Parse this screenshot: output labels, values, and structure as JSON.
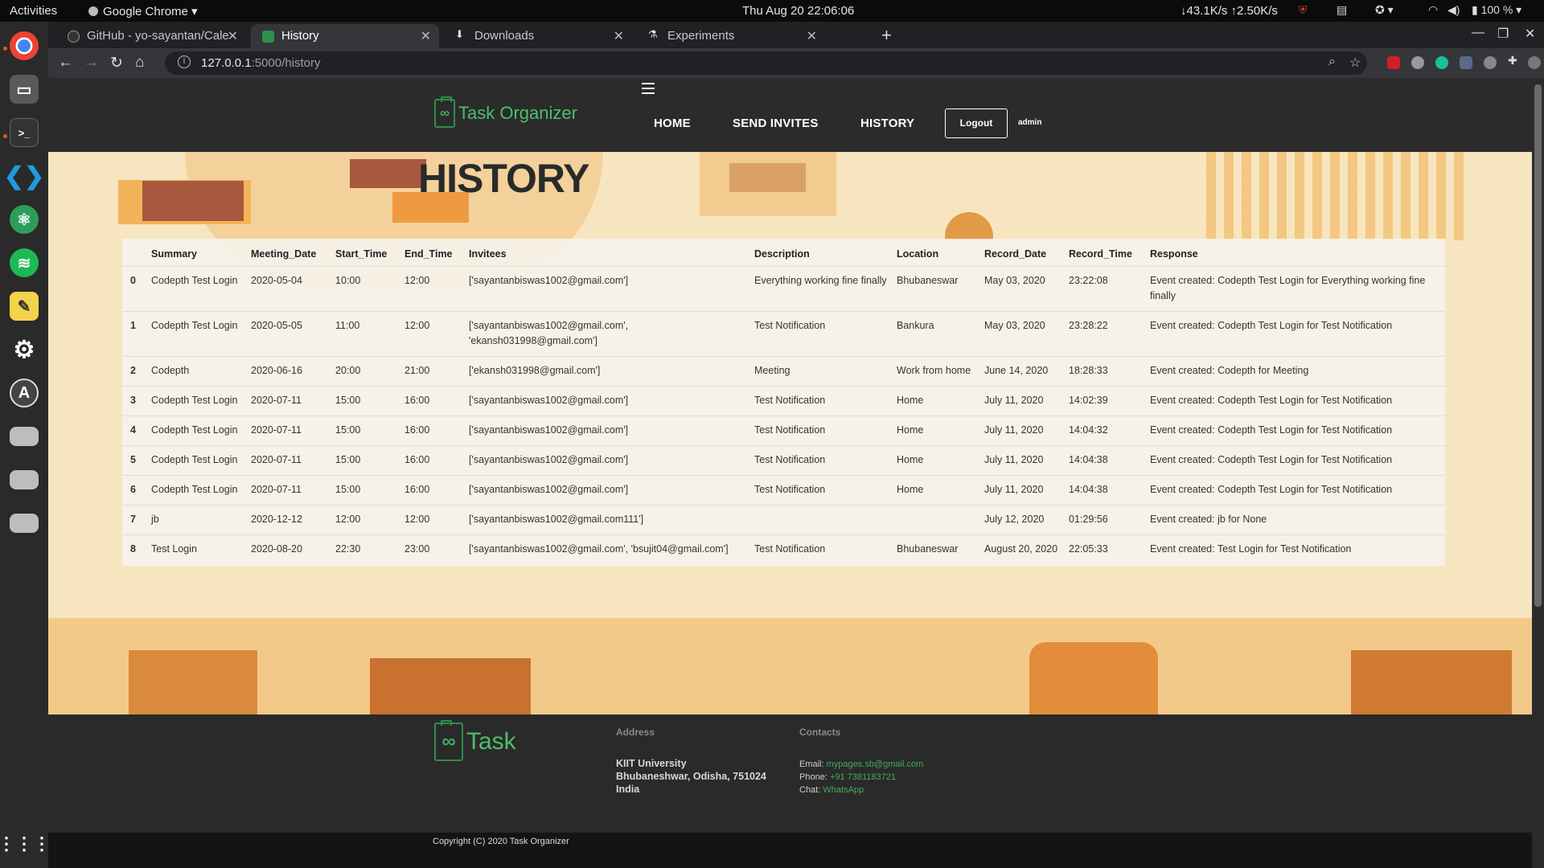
{
  "os": {
    "activities": "Activities",
    "app_name": "Google Chrome",
    "clock": "Thu Aug 20  22:06:06",
    "netspeed": "↓43.1K/s ↑2.50K/s",
    "battery": "100 %"
  },
  "browser": {
    "tabs": [
      {
        "title": "GitHub - yo-sayantan/Cale",
        "active": false
      },
      {
        "title": "History",
        "active": true
      },
      {
        "title": "Downloads",
        "active": false
      },
      {
        "title": "Experiments",
        "active": false
      }
    ],
    "url_host": "127.0.0.1",
    "url_path": ":5000/history"
  },
  "site": {
    "brand": "Task Organizer",
    "nav": {
      "home": "HOME",
      "send_invites": "SEND INVITES",
      "history": "HISTORY",
      "logout": "Logout",
      "user": "admin"
    },
    "title": "HISTORY",
    "table": {
      "headers": [
        "",
        "Summary",
        "Meeting_Date",
        "Start_Time",
        "End_Time",
        "Invitees",
        "Description",
        "Location",
        "Record_Date",
        "Record_Time",
        "Response"
      ],
      "rows": [
        [
          "0",
          "Codepth Test Login",
          "2020-05-04",
          "10:00",
          "12:00",
          "['sayantanbiswas1002@gmail.com']",
          "Everything working fine finally",
          "Bhubaneswar",
          "May 03, 2020",
          "23:22:08",
          "Event created: Codepth Test Login for Everything working fine finally"
        ],
        [
          "1",
          "Codepth Test Login",
          "2020-05-05",
          "11:00",
          "12:00",
          "['sayantanbiswas1002@gmail.com', 'ekansh031998@gmail.com']",
          "Test Notification",
          "Bankura",
          "May 03, 2020",
          "23:28:22",
          "Event created: Codepth Test Login for Test Notification"
        ],
        [
          "2",
          "Codepth",
          "2020-06-16",
          "20:00",
          "21:00",
          "['ekansh031998@gmail.com']",
          "Meeting",
          "Work from home",
          "June 14, 2020",
          "18:28:33",
          "Event created: Codepth for Meeting"
        ],
        [
          "3",
          "Codepth Test Login",
          "2020-07-11",
          "15:00",
          "16:00",
          "['sayantanbiswas1002@gmail.com']",
          "Test Notification",
          "Home",
          "July 11, 2020",
          "14:02:39",
          "Event created: Codepth Test Login for Test Notification"
        ],
        [
          "4",
          "Codepth Test Login",
          "2020-07-11",
          "15:00",
          "16:00",
          "['sayantanbiswas1002@gmail.com']",
          "Test Notification",
          "Home",
          "July 11, 2020",
          "14:04:32",
          "Event created: Codepth Test Login for Test Notification"
        ],
        [
          "5",
          "Codepth Test Login",
          "2020-07-11",
          "15:00",
          "16:00",
          "['sayantanbiswas1002@gmail.com']",
          "Test Notification",
          "Home",
          "July 11, 2020",
          "14:04:38",
          "Event created: Codepth Test Login for Test Notification"
        ],
        [
          "6",
          "Codepth Test Login",
          "2020-07-11",
          "15:00",
          "16:00",
          "['sayantanbiswas1002@gmail.com']",
          "Test Notification",
          "Home",
          "July 11, 2020",
          "14:04:38",
          "Event created: Codepth Test Login for Test Notification"
        ],
        [
          "7",
          "jb",
          "2020-12-12",
          "12:00",
          "12:00",
          "['sayantanbiswas1002@gmail.com111']",
          "",
          "",
          "July 12, 2020",
          "01:29:56",
          "Event created: jb for None"
        ],
        [
          "8",
          "Test Login",
          "2020-08-20",
          "22:30",
          "23:00",
          "['sayantanbiswas1002@gmail.com', 'bsujit04@gmail.com']",
          "Test Notification",
          "Bhubaneswar",
          "August 20, 2020",
          "22:05:33",
          "Event created: Test Login for Test Notification"
        ]
      ]
    },
    "footer": {
      "brand": "Task",
      "address_heading": "Address",
      "address_lines": [
        "KIIT University",
        "Bhubaneshwar, Odisha, 751024",
        "India"
      ],
      "contacts_heading": "Contacts",
      "email_label": "Email:",
      "email": "mypages.sb@gmail.com",
      "phone_label": "Phone:",
      "phone": "+91 7381183721",
      "chat_label": "Chat:",
      "chat": "WhatsApp",
      "copyright": "Copyright (C) 2020 Task Organizer"
    }
  },
  "colors": {
    "brand_green": "#4cbf6b",
    "hero_bg": "#f7e5c0",
    "header_bg": "#2b2b2b"
  }
}
